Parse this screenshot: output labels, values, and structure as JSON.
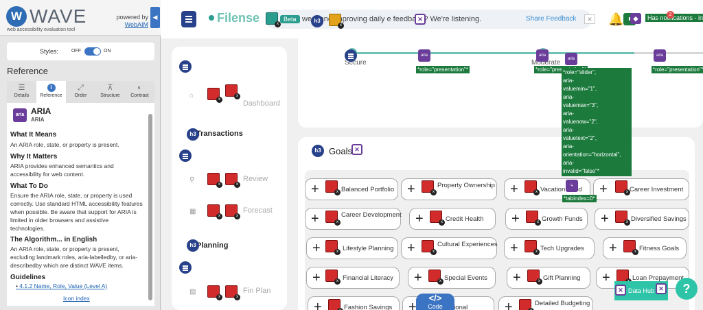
{
  "wave": {
    "logo_letter": "W",
    "title": "WAVE",
    "tagline": "web accessibility evaluation tool",
    "powered_by": "powered by",
    "webaim": "WebAIM",
    "collapse_glyph": "◀",
    "styles_label": "Styles:",
    "styles_off": "OFF",
    "styles_on": "ON",
    "reference_heading": "Reference",
    "tabs": [
      {
        "label": "Details",
        "icon": "list-icon",
        "glyph": "☰"
      },
      {
        "label": "Reference",
        "icon": "info-icon",
        "glyph": "i"
      },
      {
        "label": "Order",
        "icon": "order-icon",
        "glyph": "⤢"
      },
      {
        "label": "Structure",
        "icon": "structure-icon",
        "glyph": "⊼"
      },
      {
        "label": "Contrast",
        "icon": "contrast-icon",
        "glyph": "◐"
      }
    ],
    "ref": {
      "badge": "aria",
      "title": "ARIA",
      "subtitle": "ARIA",
      "what_means_h": "What It Means",
      "what_means": "An ARIA role, state, or property is present.",
      "why_matters_h": "Why It Matters",
      "why_matters": "ARIA provides enhanced semantics and accessibility for web content.",
      "what_do_h": "What To Do",
      "what_do": "Ensure the ARIA role, state, or property is used correctly. Use standard HTML accessibility features when possible. Be aware that support for ARIA is limited in older browsers and assistive technologies.",
      "algorithm_h": "The Algorithm... in English",
      "algorithm": "An ARIA role, state, or property is present, excluding landmark roles, aria-labelledby, or aria-describedby which are distinct WAVE items.",
      "guidelines_h": "Guidelines",
      "guideline_link": "4.1.2 Name, Role, Value (Level A)",
      "icon_index": "Icon index"
    }
  },
  "app": {
    "brand": "Filense",
    "beta": "Beta",
    "announcement": "we        s and improving daily        e feedback? We're listening.",
    "share_feedback": "Share Feedback",
    "close_glyph": "✕",
    "bell_glyph": "🔔",
    "notifications_label": "Has notifications - in ne",
    "notif_count": "2",
    "nav": {
      "dashboard": "Dashboard",
      "transactions": "Transactions",
      "review": "Review",
      "forecast": "Forecast",
      "planning": "Planning",
      "fin_plan": "Fin Plan"
    },
    "stepper": {
      "steps": [
        "Secure",
        "Moderate"
      ],
      "role_tag": "*role=\"presentation\"*",
      "slider_tag": "*role=\"slider\",\naria-\nvaluemin=\"1\",\naria-\nvaluemax=\"3\",\naria-\nvaluenow=\"2\",\naria-\nvaluetext=\"2\",\naria-\norientation=\"horizontal\",\naria-\ninvalid=\"false\"*",
      "tabindex_tag": "*tabindex=0*"
    },
    "goals_title": "Goals",
    "goals": [
      "Balanced Portfolio",
      "Property Ownership",
      "Vacation Fund",
      "Career Investment",
      "Career Development",
      "Credit Health",
      "Growth Funds",
      "Diversified Savings",
      "Lifestyle Planning",
      "Cultural Experiences",
      "Tech Upgrades",
      "Fitness Goals",
      "Financial Literacy",
      "Special Events",
      "Gift Planning",
      "Loan Prepayment",
      "Fashion Savings",
      "Emotional",
      "Detailed Budgeting"
    ],
    "code_label": "Code",
    "code_glyph": "</>",
    "data_hub": "Data Hub",
    "help_glyph": "?",
    "colors": {
      "accent": "#6ec3b5",
      "wave_blue": "#27418a",
      "aria_purple": "#6a3d9a",
      "error_red": "#d12b2b",
      "tag_green": "#1b7a3c"
    }
  }
}
